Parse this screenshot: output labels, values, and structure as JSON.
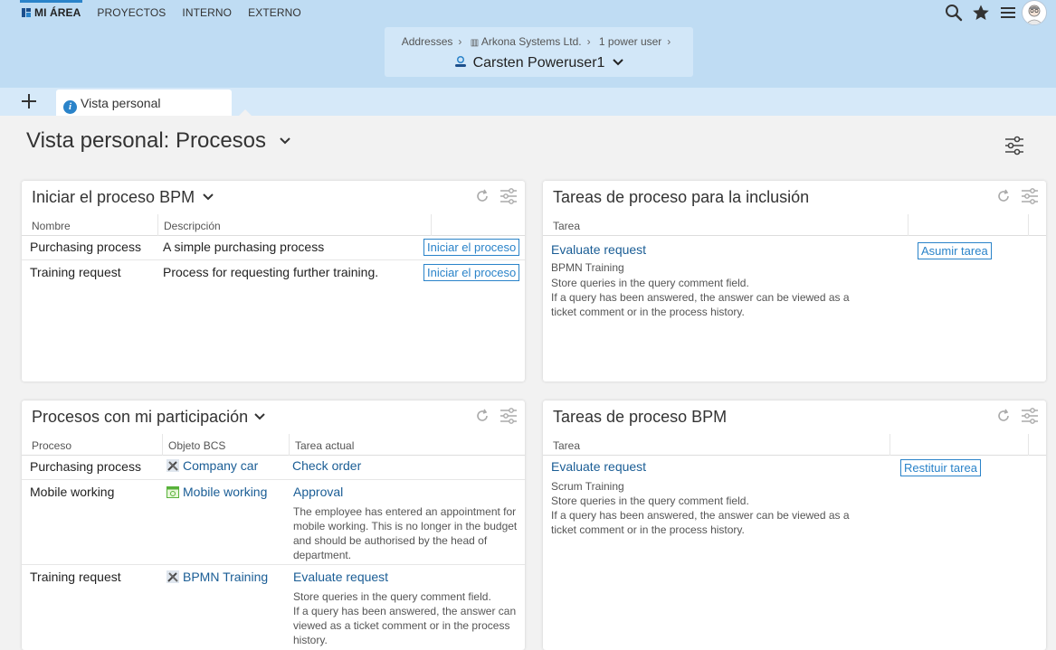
{
  "topnav": {
    "items": [
      "MI ÁREA",
      "PROYECTOS",
      "INTERNO",
      "EXTERNO"
    ]
  },
  "breadcrumb": {
    "items": [
      "Addresses",
      "Arkona Systems Ltd.",
      "1 power user"
    ],
    "title": "Carsten Poweruser1"
  },
  "tab": {
    "label": "Vista personal"
  },
  "page": {
    "title": "Vista personal: Procesos"
  },
  "panel_start": {
    "title": "Iniciar el proceso BPM",
    "col_name": "Nombre",
    "col_desc": "Descripción",
    "rows": [
      {
        "name": "Purchasing process",
        "desc": "A simple purchasing process",
        "action": "Iniciar el proceso"
      },
      {
        "name": "Training request",
        "desc": "Process for requesting further training.",
        "action": "Iniciar el proceso"
      }
    ]
  },
  "panel_inclusion": {
    "title": "Tareas de proceso para la inclusión",
    "col_task": "Tarea",
    "task_link": "Evaluate request",
    "task_sub": "BPMN Training",
    "task_desc1": "Store queries in the query comment field.",
    "task_desc2": "If a query has been answered, the answer can be viewed as a",
    "task_desc3": "ticket comment or in the process history.",
    "action": "Asumir tarea"
  },
  "panel_participation": {
    "title": "Procesos con mi participación",
    "col_process": "Proceso",
    "col_object": "Objeto BCS",
    "col_task": "Tarea actual",
    "rows": [
      {
        "process": "Purchasing process",
        "object": "Company car",
        "task": "Check order"
      },
      {
        "process": "Mobile working",
        "object": "Mobile working",
        "task": "Approval",
        "d1": "The employee has entered an appointment for",
        "d2": "mobile working. This is no longer in the budget",
        "d3": "and should be authorised by the head of",
        "d4": "department."
      },
      {
        "process": "Training request",
        "object": "BPMN Training",
        "task": "Evaluate request",
        "d1": "Store queries in the query comment field.",
        "d2": "If a query has been answered, the answer can",
        "d3": "viewed as a ticket comment or in the process",
        "d4": "history."
      }
    ]
  },
  "panel_bpm": {
    "title": "Tareas de proceso BPM",
    "col_task": "Tarea",
    "task_link": "Evaluate request",
    "task_sub": "Scrum Training",
    "task_desc1": "Store queries in the query comment field.",
    "task_desc2": "If a query has been answered, the answer can be viewed as a",
    "task_desc3": "ticket comment or in the process history.",
    "action": "Restituir tarea"
  },
  "colors": {
    "accent": "#2a83c9",
    "header": "#bfdcf3",
    "link": "#1a5d95"
  }
}
